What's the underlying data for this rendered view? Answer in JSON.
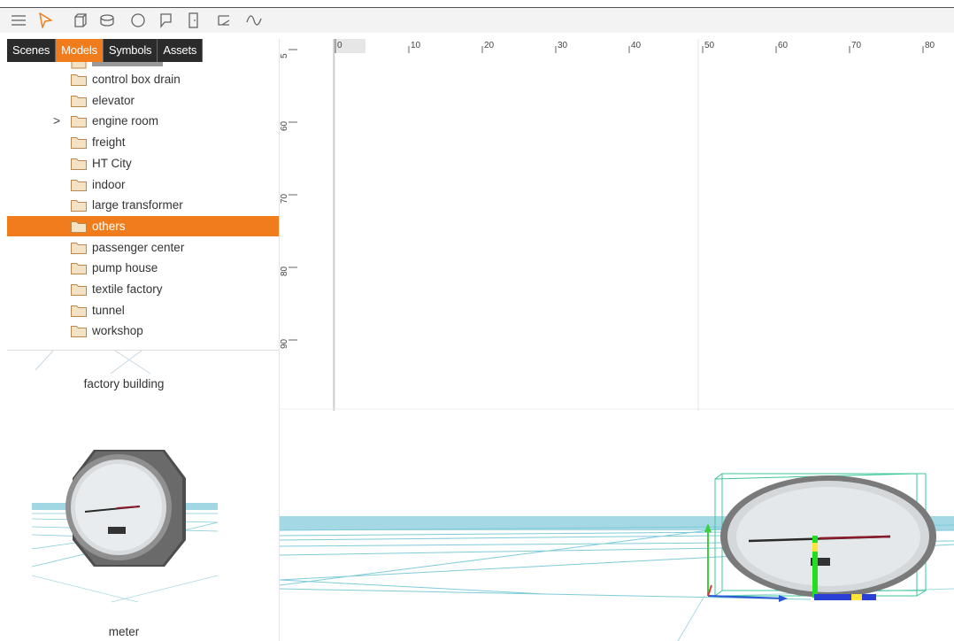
{
  "toolbar": {
    "icons": [
      "menu-icon",
      "select-pointer-icon",
      "box-icon",
      "cylinder-icon",
      "sphere-icon",
      "polygon-icon",
      "door-icon",
      "plane-icon",
      "curve-icon"
    ]
  },
  "tabs": [
    {
      "label": "Scenes",
      "active": false
    },
    {
      "label": "Models",
      "active": true
    },
    {
      "label": "Symbols",
      "active": false
    },
    {
      "label": "Assets",
      "active": false
    }
  ],
  "tree": {
    "items": [
      {
        "label": "control box drain",
        "expandable": false,
        "selected": false
      },
      {
        "label": "elevator",
        "expandable": false,
        "selected": false
      },
      {
        "label": "engine room",
        "expandable": true,
        "selected": false
      },
      {
        "label": "freight",
        "expandable": false,
        "selected": false
      },
      {
        "label": "HT City",
        "expandable": false,
        "selected": false
      },
      {
        "label": "indoor",
        "expandable": false,
        "selected": false
      },
      {
        "label": "large transformer",
        "expandable": false,
        "selected": false
      },
      {
        "label": "others",
        "expandable": false,
        "selected": true
      },
      {
        "label": "passenger center",
        "expandable": false,
        "selected": false
      },
      {
        "label": "pump house",
        "expandable": false,
        "selected": false
      },
      {
        "label": "textile factory",
        "expandable": false,
        "selected": false
      },
      {
        "label": "tunnel",
        "expandable": false,
        "selected": false
      },
      {
        "label": "workshop",
        "expandable": false,
        "selected": false
      }
    ]
  },
  "models": [
    {
      "label": "factory building"
    },
    {
      "label": "meter"
    }
  ],
  "ruler": {
    "x_ticks": [
      "0",
      "10",
      "20",
      "30",
      "40",
      "50",
      "60",
      "70",
      "80"
    ],
    "y_ticks": [
      "5",
      "60",
      "70",
      "80",
      "90"
    ]
  },
  "colors": {
    "accent": "#f07c1b",
    "tab_bg": "#2b2b2b",
    "grid_line": "#5bc0d0",
    "bbox": "#3cc79a"
  }
}
